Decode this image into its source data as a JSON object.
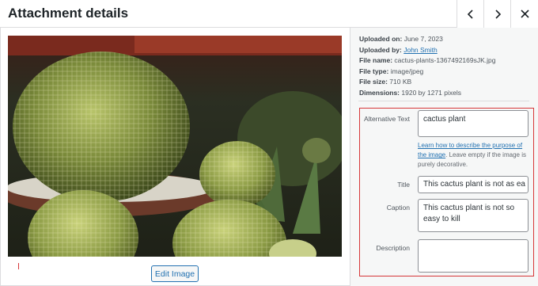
{
  "header": {
    "title": "Attachment details",
    "prev_icon": "chevron-left-icon",
    "next_icon": "chevron-right-icon",
    "close_icon": "close-icon"
  },
  "image": {
    "alt": "cactus plant"
  },
  "edit_button": "Edit Image",
  "meta": {
    "uploaded_on_label": "Uploaded on:",
    "uploaded_on": "June 7, 2023",
    "uploaded_by_label": "Uploaded by:",
    "uploaded_by": "John Smith",
    "file_name_label": "File name:",
    "file_name": "cactus-plants-1367492169sJK.jpg",
    "file_type_label": "File type:",
    "file_type": "image/jpeg",
    "file_size_label": "File size:",
    "file_size": "710 KB",
    "dimensions_label": "Dimensions:",
    "dimensions": "1920 by 1271 pixels"
  },
  "fields": {
    "alt_label": "Alternative Text",
    "alt_value": "cactus plant",
    "help_link": "Learn how to describe the purpose of the image",
    "help_text": ". Leave empty if the image is purely decorative.",
    "title_label": "Title",
    "title_value": "This cactus plant is not as ea",
    "caption_label": "Caption",
    "caption_value": "This cactus plant is not so easy to kill",
    "description_label": "Description",
    "description_value": ""
  },
  "colors": {
    "accent": "#2271b1",
    "highlight_border": "#d63638",
    "sidebar_bg": "#f6f7f7"
  }
}
